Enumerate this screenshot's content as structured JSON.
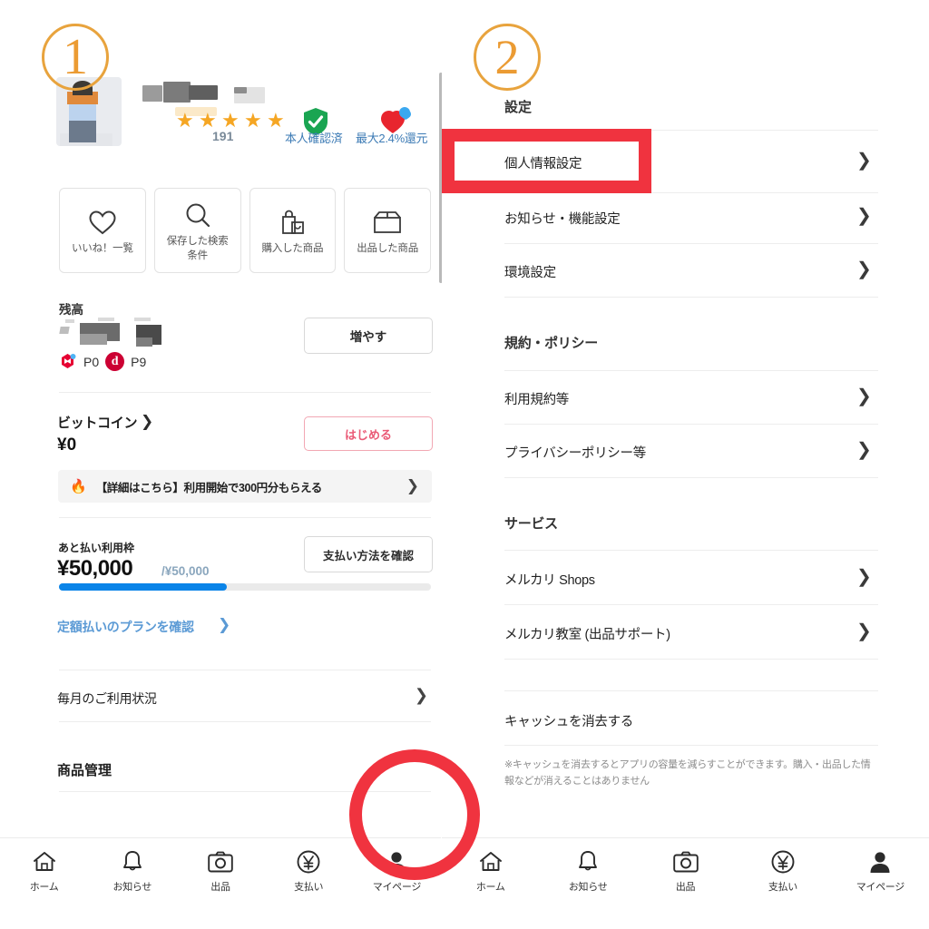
{
  "annotations": {
    "step1": "①",
    "step1_num": "1",
    "step2_num": "2",
    "step2_caption": "設定",
    "highlight_color": "#f0333f",
    "circle_color": "#e8a33d"
  },
  "left": {
    "profile": {
      "username_redacted": true,
      "rating_count": "191",
      "verified_label": "本人確認済",
      "cashback_label": "最大2.4%還元",
      "stars": 5
    },
    "quick_tiles": [
      {
        "icon": "heart-icon",
        "label": "いいね！一覧"
      },
      {
        "icon": "search-icon",
        "label": "保存した検索\n条件",
        "line1": "保存した検索",
        "line2": "条件"
      },
      {
        "icon": "shopping-bag-icon",
        "label": "購入した商品"
      },
      {
        "icon": "box-icon",
        "label": "出品した商品"
      }
    ],
    "balance": {
      "section_label": "残高",
      "amount_redacted": true,
      "points": [
        {
          "icon": "mercari-icon",
          "value": "P0"
        },
        {
          "icon": "dpoint-icon",
          "value": "P9"
        }
      ],
      "add_button": "増やす"
    },
    "bitcoin": {
      "title": "ビットコイン",
      "chevron": "❯",
      "amount": "¥0",
      "start_button": "はじめる"
    },
    "promo": {
      "icon": "fire-icon",
      "text": "【詳細はこちら】利用開始で300円分もらえる",
      "chevron": "❯"
    },
    "afterpay": {
      "label": "あと払い利用枠",
      "amount": "¥50,000",
      "max": "/¥50,000",
      "progress_percent": 45,
      "bar_color": "#0a84e8",
      "check_button": "支払い方法を確認",
      "plan_link": "定額払いのプランを確認",
      "plan_chevron": "❯"
    },
    "monthly_usage": {
      "label": "毎月のご利用状況",
      "chevron": "❯"
    },
    "product_mgmt_title": "商品管理",
    "tabbar": [
      {
        "icon": "home-icon",
        "label": "ホーム",
        "active": false
      },
      {
        "icon": "bell-icon",
        "label": "お知らせ",
        "active": false
      },
      {
        "icon": "camera-icon",
        "label": "出品",
        "active": false
      },
      {
        "icon": "yen-icon",
        "label": "支払い",
        "active": false
      },
      {
        "icon": "person-icon",
        "label": "マイページ",
        "active": true
      }
    ]
  },
  "right": {
    "header": "設定",
    "settings_items": [
      {
        "label": "個人情報設定",
        "chevron": "❯",
        "highlighted": true
      },
      {
        "label": "お知らせ・機能設定",
        "chevron": "❯",
        "highlighted": false
      },
      {
        "label": "環境設定",
        "chevron": "❯",
        "highlighted": false
      }
    ],
    "policy_section": "規約・ポリシー",
    "policy_items": [
      {
        "label": "利用規約等",
        "chevron": "❯"
      },
      {
        "label": "プライバシーポリシー等",
        "chevron": "❯"
      }
    ],
    "service_section": "サービス",
    "service_items": [
      {
        "label": "メルカリ Shops",
        "chevron": "❯"
      },
      {
        "label": "メルカリ教室 (出品サポート)",
        "chevron": "❯"
      }
    ],
    "cache_item": "キャッシュを消去する",
    "cache_note": "※キャッシュを消去するとアプリの容量を減らすことができます。購入・出品した情報などが消えることはありません",
    "tabbar": [
      {
        "icon": "home-icon",
        "label": "ホーム",
        "active": false
      },
      {
        "icon": "bell-icon",
        "label": "お知らせ",
        "active": false
      },
      {
        "icon": "camera-icon",
        "label": "出品",
        "active": false
      },
      {
        "icon": "yen-icon",
        "label": "支払い",
        "active": false
      },
      {
        "icon": "person-icon",
        "label": "マイページ",
        "active": true
      }
    ]
  }
}
